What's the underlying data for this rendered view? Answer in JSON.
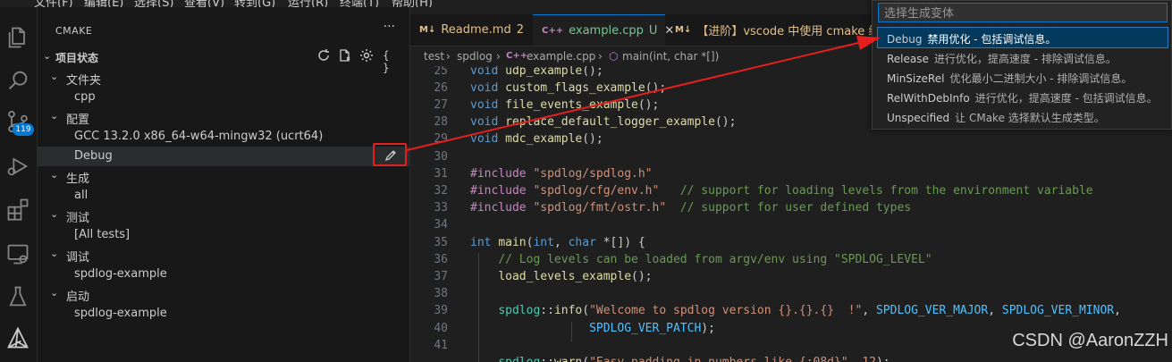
{
  "menubar": {
    "items": [
      "文件(F)",
      "编辑(E)",
      "选择(S)",
      "查看(V)",
      "转到(G)",
      "运行(R)",
      "终端(T)",
      "帮助(H)"
    ]
  },
  "activity": {
    "icons": [
      "files-icon",
      "search-icon",
      "source-control-icon",
      "run-debug-icon",
      "extensions-icon",
      "remote-explorer-icon",
      "testing-icon",
      "cmake-icon"
    ],
    "scm_badge": "119"
  },
  "sidebar": {
    "title": "CMAKE",
    "more": "···",
    "section_title": "项目状态",
    "tree": [
      {
        "label": "文件夹",
        "level": 0,
        "expanded": true
      },
      {
        "label": "cpp",
        "level": 1
      },
      {
        "label": "配置",
        "level": 0,
        "expanded": true
      },
      {
        "label": "GCC 13.2.0 x86_64-w64-mingw32 (ucrt64)",
        "level": 1
      },
      {
        "label": "Debug",
        "level": 1,
        "selected": true
      },
      {
        "label": "生成",
        "level": 0,
        "expanded": true
      },
      {
        "label": "all",
        "level": 1
      },
      {
        "label": "测试",
        "level": 0,
        "expanded": true
      },
      {
        "label": "[All tests]",
        "level": 1
      },
      {
        "label": "调试",
        "level": 0,
        "expanded": true
      },
      {
        "label": "spdlog-example",
        "level": 1
      },
      {
        "label": "启动",
        "level": 0,
        "expanded": true
      },
      {
        "label": "spdlog-example",
        "level": 1
      }
    ]
  },
  "tabs": [
    {
      "icon": "M↓",
      "name": "Readme.md",
      "mark": "2",
      "color": "#e2c08d",
      "active": false
    },
    {
      "icon": "C++",
      "name": "example.cpp",
      "mark": "U",
      "color": "#73c991",
      "active": true,
      "close": "✕"
    },
    {
      "icon": "M↓",
      "name": "【进阶】vscode 中使用 cmake 编译",
      "mark": "",
      "color": "#e2c08d",
      "active": false
    }
  ],
  "breadcrumb": {
    "parts": [
      "test",
      "spdlog",
      "example.cpp",
      "main(int, char *[])"
    ],
    "sep": "›"
  },
  "editor": {
    "line_numbers": [
      "25",
      "26",
      "27",
      "28",
      "29",
      "30",
      "31",
      "32",
      "33",
      "34",
      "35",
      "36",
      "37",
      "38",
      "39",
      "40",
      "41"
    ]
  },
  "quickpick": {
    "placeholder": "选择生成变体",
    "items": [
      {
        "name": "Debug",
        "desc": "禁用优化 - 包括调试信息。",
        "selected": true
      },
      {
        "name": "Release",
        "desc": "进行优化，提高速度 - 排除调试信息。"
      },
      {
        "name": "MinSizeRel",
        "desc": "优化最小二进制大小 - 排除调试信息。"
      },
      {
        "name": "RelWithDebInfo",
        "desc": "进行优化，提高速度 - 包括调试信息。"
      },
      {
        "name": "Unspecified",
        "desc": "让 CMake 选择默认生成类型。"
      }
    ]
  },
  "watermark": "CSDN @AaronZZH",
  "colors": {
    "accent": "#0078d4",
    "annotation": "#e51f1f"
  }
}
